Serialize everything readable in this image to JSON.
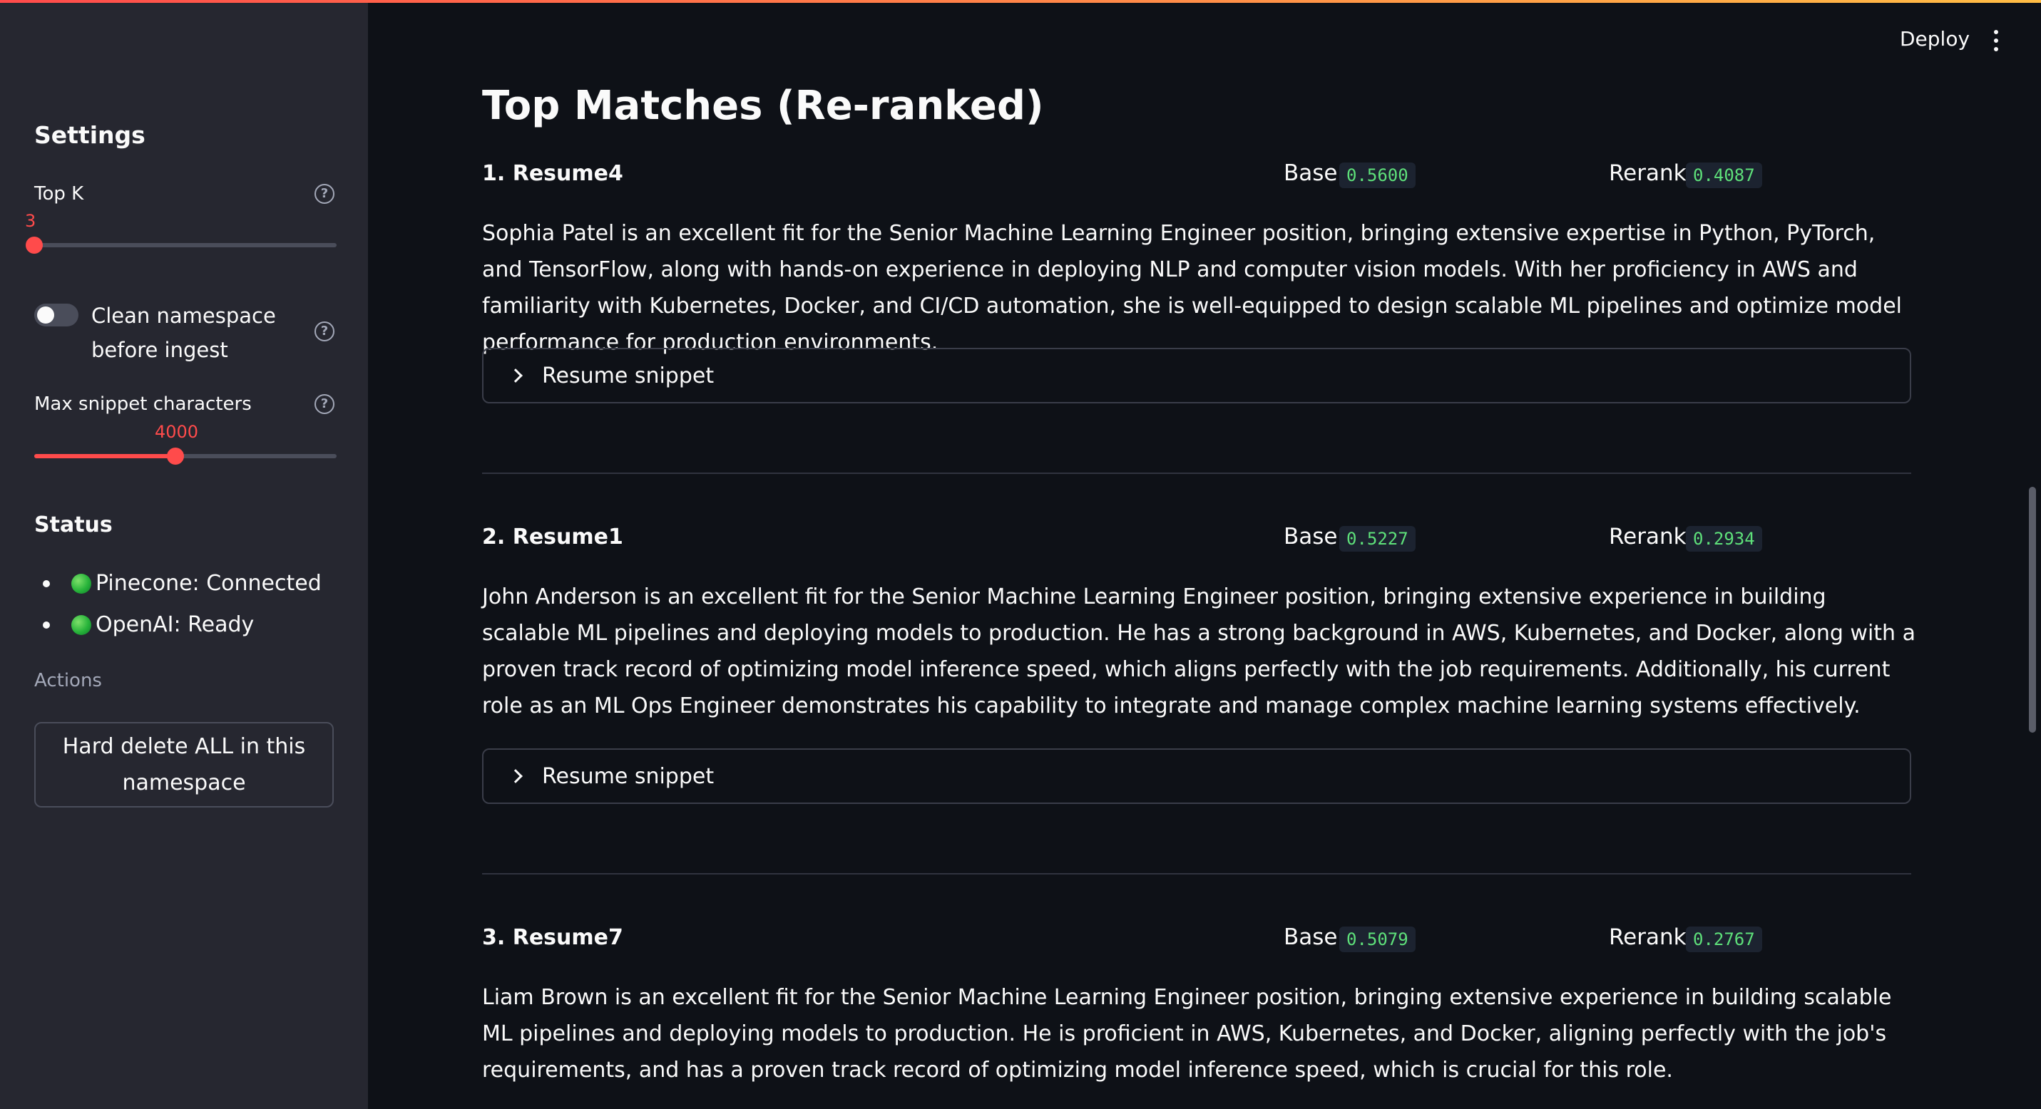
{
  "header": {
    "deploy_label": "Deploy"
  },
  "sidebar": {
    "title": "Settings",
    "top_k": {
      "label": "Top K",
      "value": "3"
    },
    "clean_namespace": {
      "label": "Clean namespace before ingest",
      "enabled": false
    },
    "max_snippet": {
      "label": "Max snippet characters",
      "value": "4000"
    },
    "status": {
      "title": "Status",
      "items": [
        "Pinecone: Connected",
        "OpenAI: Ready"
      ]
    },
    "actions": {
      "label": "Actions",
      "hard_delete_label": "Hard delete ALL in this namespace"
    }
  },
  "main": {
    "title": "Top Matches (Re-ranked)",
    "base_label": "Base:",
    "rerank_label": "Rerank:",
    "snippet_label": "Resume snippet",
    "matches": [
      {
        "name": "1. Resume4",
        "base": "0.5600",
        "rerank": "0.4087",
        "summary": "Sophia Patel is an excellent fit for the Senior Machine Learning Engineer position, bringing extensive expertise in Python, PyTorch, and TensorFlow, along with hands-on experience in deploying NLP and computer vision models. With her proficiency in AWS and familiarity with Kubernetes, Docker, and CI/CD automation, she is well-equipped to design scalable ML pipelines and optimize model performance for production environments."
      },
      {
        "name": "2. Resume1",
        "base": "0.5227",
        "rerank": "0.2934",
        "summary": "John Anderson is an excellent fit for the Senior Machine Learning Engineer position, bringing extensive experience in building scalable ML pipelines and deploying models to production. He has a strong background in AWS, Kubernetes, and Docker, along with a proven track record of optimizing model inference speed, which aligns perfectly with the job requirements. Additionally, his current role as an ML Ops Engineer demonstrates his capability to integrate and manage complex machine learning systems effectively."
      },
      {
        "name": "3. Resume7",
        "base": "0.5079",
        "rerank": "0.2767",
        "summary": "Liam Brown is an excellent fit for the Senior Machine Learning Engineer position, bringing extensive experience in building scalable ML pipelines and deploying models to production. He is proficient in AWS, Kubernetes, and Docker, aligning perfectly with the job's requirements, and has a proven track record of optimizing model inference speed, which is crucial for this role."
      }
    ]
  }
}
